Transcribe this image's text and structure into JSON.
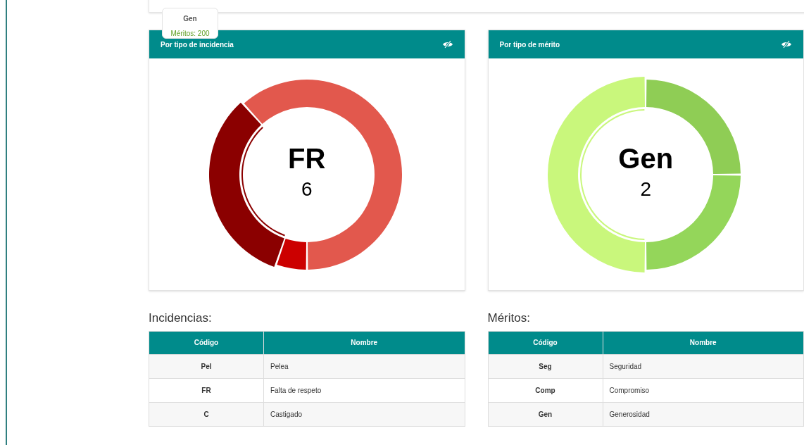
{
  "tooltip": {
    "title": "Gen",
    "text": "Méritos: 200"
  },
  "charts": [
    {
      "title": "Por tipo de incidencia",
      "center_label": "FR",
      "center_value": "6"
    },
    {
      "title": "Por tipo de mérito",
      "center_label": "Gen",
      "center_value": "2"
    }
  ],
  "tables": [
    {
      "heading": "Incidencias:",
      "columns": [
        "Código",
        "Nombre"
      ],
      "rows": [
        [
          "Pel",
          "Pelea"
        ],
        [
          "FR",
          "Falta de respeto"
        ],
        [
          "C",
          "Castigado"
        ]
      ]
    },
    {
      "heading": "Méritos:",
      "columns": [
        "Código",
        "Nombre"
      ],
      "rows": [
        [
          "Seg",
          "Seguridad"
        ],
        [
          "Comp",
          "Compromiso"
        ],
        [
          "Gen",
          "Generosidad"
        ]
      ]
    }
  ]
}
